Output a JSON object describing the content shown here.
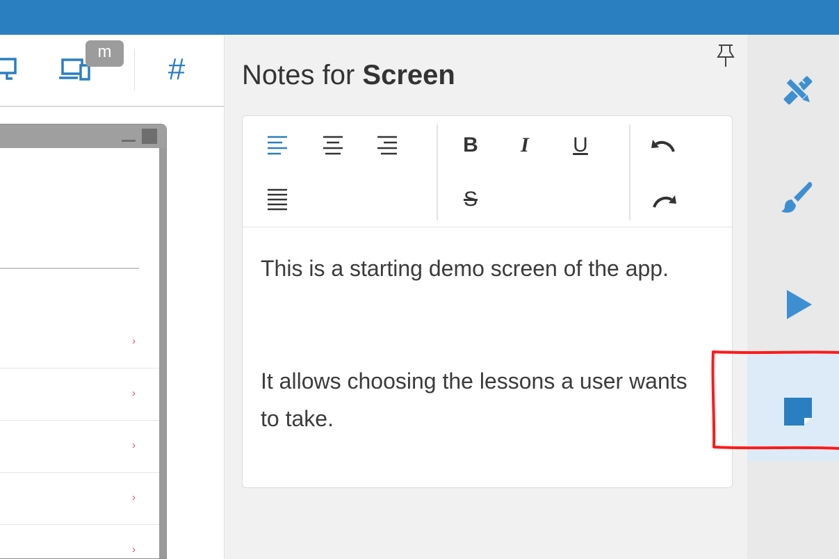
{
  "toolbar": {
    "device_badge": "m",
    "grid_label": "#"
  },
  "notes": {
    "title_prefix": "Notes for",
    "title_subject": "Screen",
    "formatting": {
      "align_left": "align-left-icon",
      "align_center": "align-center-icon",
      "align_right": "align-right-icon",
      "justify": "justify-icon",
      "bold": "B",
      "italic": "I",
      "underline": "U",
      "strikethrough": "S",
      "undo": "undo-icon",
      "redo": "redo-icon"
    },
    "paragraphs": [
      "This is a starting demo screen of the app.",
      "It allows choosing the lessons a user wants to take."
    ]
  },
  "left_panel": {
    "list_chevron": "›"
  },
  "right_rail": {
    "items": [
      "design-tools-icon",
      "brush-icon",
      "play-icon",
      "notes-icon"
    ],
    "active": "notes-icon"
  },
  "colors": {
    "accent": "#2a7fc0",
    "rail_icon": "#3e8fd1",
    "chevron": "#e2457b",
    "highlight_outline": "#ff1a1a"
  }
}
